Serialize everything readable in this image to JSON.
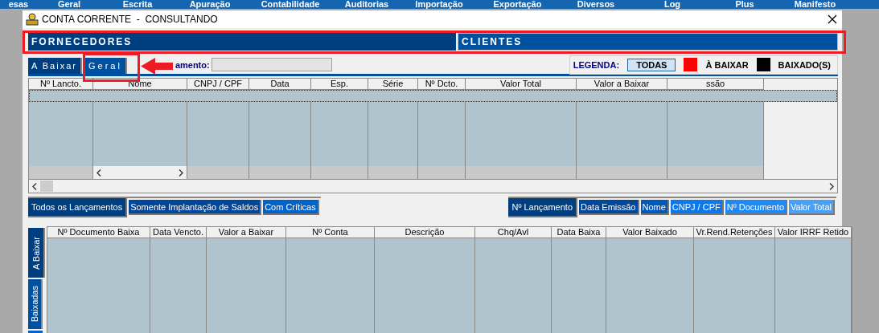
{
  "menu_bar": [
    "esas",
    "Geral",
    "Escrita",
    "Apuração",
    "Contabilidade",
    "Auditorias",
    "Importação",
    "Exportação",
    "Diversos",
    "Log",
    "Plus",
    "Manifesto"
  ],
  "window": {
    "title": "CONTA CORRENTE  -  CONSULTANDO"
  },
  "party_tabs": [
    {
      "label": "FORNECEDORES",
      "selected": true
    },
    {
      "label": "CLIENTES",
      "selected": false
    }
  ],
  "view_tabs": [
    {
      "label": "A Baixar",
      "selected": false
    },
    {
      "label": "Geral",
      "selected": true
    }
  ],
  "filter": {
    "label": "amento:"
  },
  "legend": {
    "title": "LEGENDA:",
    "items": [
      {
        "kind": "button",
        "label": "TODAS"
      },
      {
        "kind": "swatch",
        "label": "À BAIXAR",
        "color": "#ff0000"
      },
      {
        "kind": "swatch",
        "label": "BAIXADO(S)",
        "color": "#000000"
      }
    ]
  },
  "entries_table": {
    "columns": [
      "Nº Lancto.",
      "Nome",
      "CNPJ / CPF",
      "Data",
      "Esp.",
      "Série",
      "Nº Dcto.",
      "Valor Total",
      "Valor a Baixar",
      "ssão"
    ]
  },
  "entry_filters": [
    {
      "label": "Todos os Lançamentos",
      "selected": true,
      "color": "#003f7f"
    },
    {
      "label": "Somente Implantação de Saldos",
      "selected": false,
      "color": "#00479a"
    },
    {
      "label": "Com Críticas",
      "selected": false,
      "color": "#0063cc"
    }
  ],
  "sort_options": [
    {
      "label": "Nº Lançamento",
      "selected": true,
      "color": "#003f7f"
    },
    {
      "label": "Data Emissão",
      "selected": false,
      "color": "#00479a"
    },
    {
      "label": "Nome",
      "selected": false,
      "color": "#0058b8"
    },
    {
      "label": "CNPJ / CPF",
      "selected": false,
      "color": "#0a78ee"
    },
    {
      "label": "Nº Documento",
      "selected": false,
      "color": "#1e88f5"
    },
    {
      "label": "Valor Total",
      "selected": false,
      "color": "#4aa0f5"
    }
  ],
  "side_tabs": [
    {
      "label": "A Baixar",
      "selected": true
    },
    {
      "label": "Baixadas",
      "selected": false
    }
  ],
  "payments_table": {
    "columns": [
      "Nº Documento Baixa",
      "Data Vencto.",
      "Valor a Baixar",
      "Nº Conta",
      "Descrição",
      "Chq/Avl",
      "Data Baixa",
      "Valor Baixado",
      "Vr.Rend.Retenções",
      "Valor IRRF Retido"
    ]
  }
}
